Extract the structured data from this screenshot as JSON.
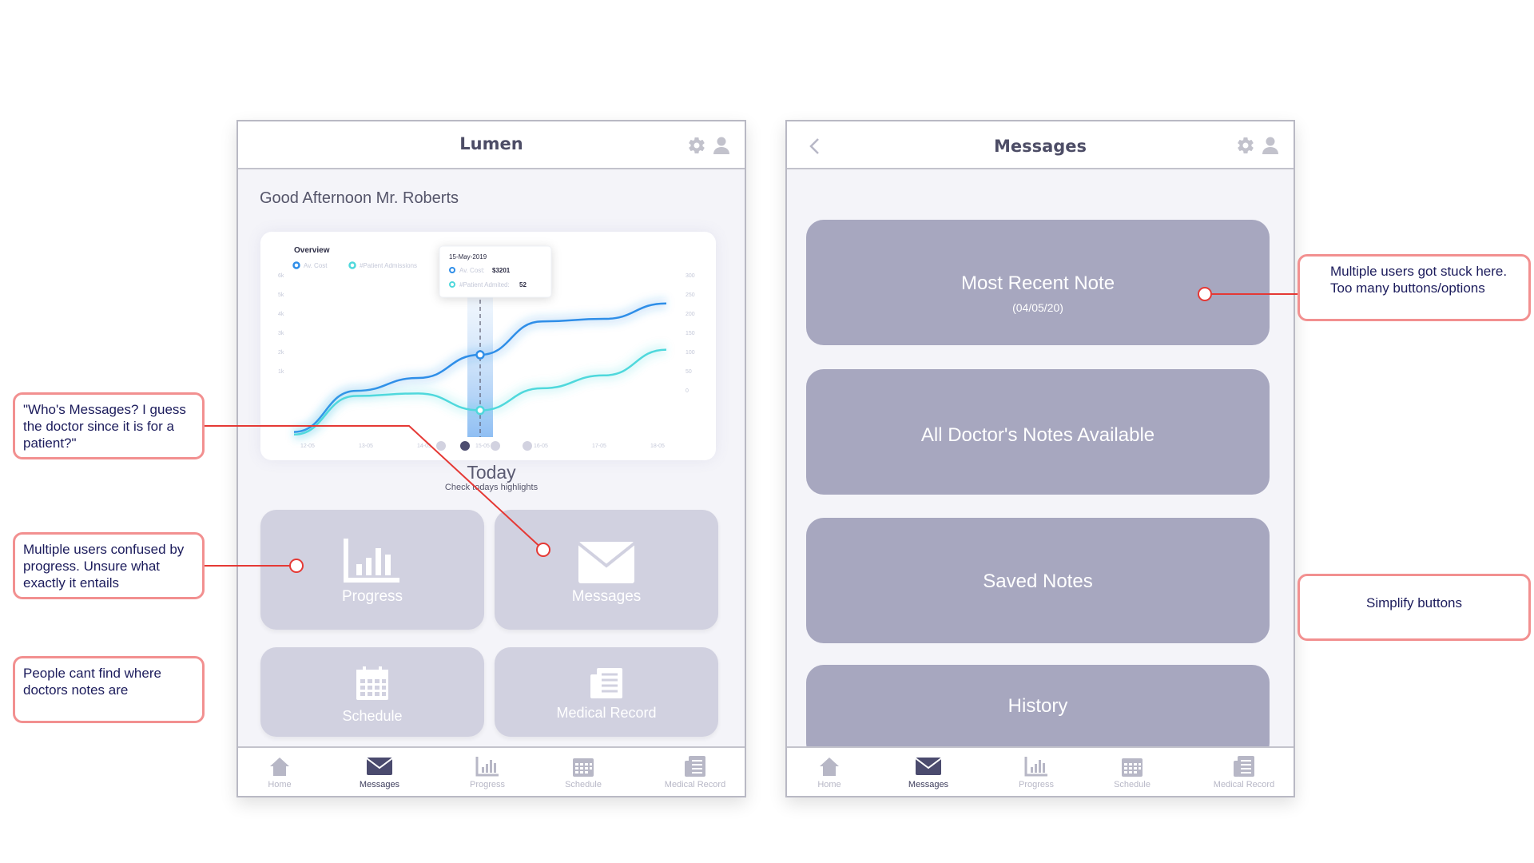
{
  "left_phone": {
    "title": "Lumen",
    "greeting": "Good Afternoon Mr. Roberts",
    "chart_card": {
      "title": "Overview",
      "legend": [
        "Av. Cost",
        "#Patient Admissions"
      ],
      "tooltip": {
        "date": "15-May-2019",
        "cost_label": "Av. Cost:",
        "cost_value": "$3201",
        "admitted_label": "#Patient Admited:",
        "admitted_value": "52"
      }
    },
    "today_label": "Today",
    "today_sub": "Check todays highlights",
    "tiles": {
      "progress": "Progress",
      "messages": "Messages",
      "schedule": "Schedule",
      "medical_record": "Medical Record"
    }
  },
  "right_phone": {
    "title": "Messages",
    "buttons": {
      "most_recent": "Most Recent Note",
      "most_recent_date": "(04/05/20)",
      "all_notes": "All Doctor's Notes Available",
      "saved": "Saved Notes",
      "history": "History"
    }
  },
  "tabbar": {
    "home": "Home",
    "messages": "Messages",
    "progress": "Progress",
    "schedule": "Schedule",
    "medical_record": "Medical Record"
  },
  "notes": {
    "whos_messages": "\"Who's Messages? I guess the doctor since it is for a patient?\"",
    "progress_confused": "Multiple users confused by progress. Unsure what exactly it entails",
    "cant_find": "People cant find where doctors notes are",
    "stuck": "Multiple users got stuck here. Too many buttons/options",
    "simplify": "Simplify buttons"
  },
  "chart_data": {
    "type": "line",
    "title": "Overview",
    "x": [
      "12-05",
      "13-05",
      "14-05",
      "15-05",
      "16-05",
      "17-05",
      "18-05"
    ],
    "series": [
      {
        "name": "Av. Cost",
        "values": [
          200,
          1800,
          2300,
          3201,
          4500,
          4600,
          5200
        ]
      },
      {
        "name": "#Patient Admissions",
        "values": [
          5,
          80,
          85,
          52,
          95,
          120,
          170
        ]
      }
    ],
    "y_left_ticks": [
      "6k",
      "5k",
      "4k",
      "3k",
      "2k",
      "1k"
    ],
    "y_right_ticks": [
      "300",
      "250",
      "200",
      "150",
      "100",
      "50",
      "0"
    ],
    "ylim_left": [
      0,
      6000
    ],
    "ylim_right": [
      0,
      300
    ],
    "highlight": "15-05",
    "colors": {
      "cost": "#2f8ee8",
      "admissions": "#4fd8dc"
    }
  },
  "colors": {
    "tile": "#d1d1e0",
    "msg_button": "#a7a7bf",
    "note_border": "#f29090",
    "connector": "#e53935"
  }
}
